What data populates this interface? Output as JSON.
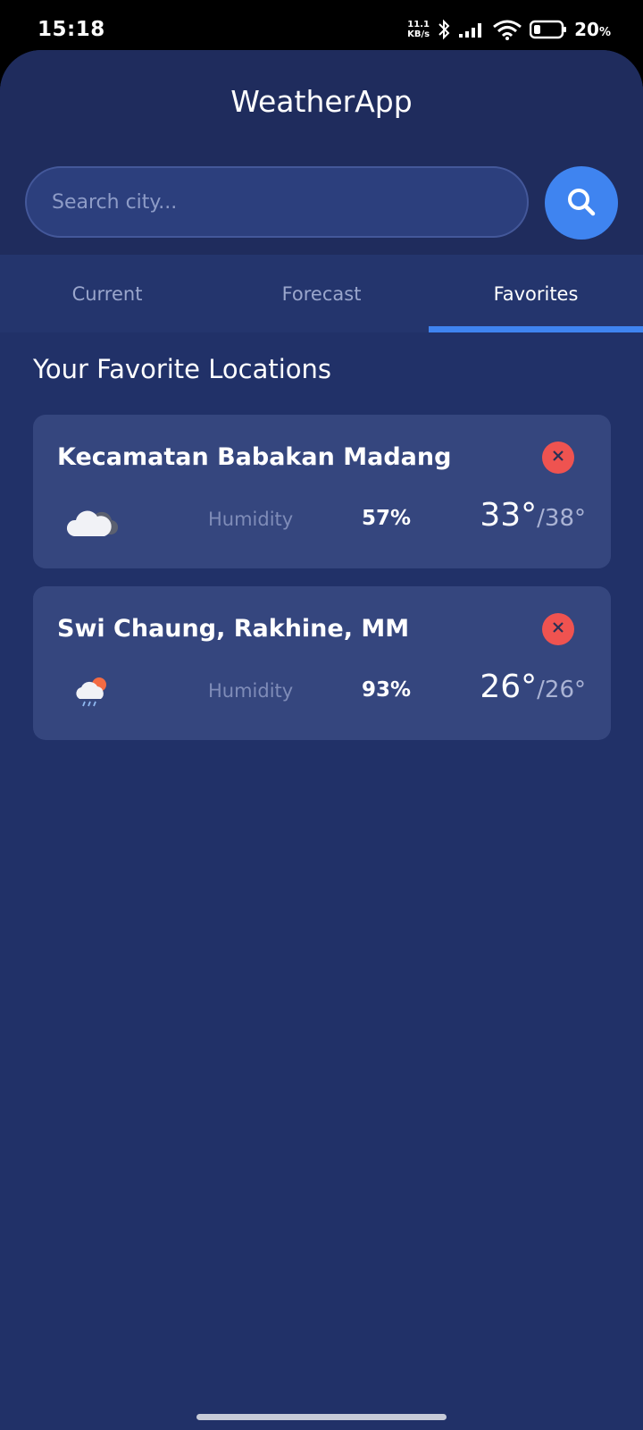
{
  "status_bar": {
    "time": "15:18",
    "net_speed_value": "11.1",
    "net_speed_unit": "KB/s",
    "battery_percent": "20",
    "battery_unit": "%"
  },
  "app": {
    "title": "WeatherApp",
    "search": {
      "placeholder": "Search city..."
    }
  },
  "tabs": [
    {
      "label": "Current",
      "active": false
    },
    {
      "label": "Forecast",
      "active": false
    },
    {
      "label": "Favorites",
      "active": true
    }
  ],
  "favorites": {
    "title": "Your Favorite Locations",
    "items": [
      {
        "name": "Kecamatan Babakan Madang",
        "icon": "cloudy-icon",
        "humidity_label": "Humidity",
        "humidity": "57%",
        "temp_now": "33°",
        "temp_max": "38°"
      },
      {
        "name": "Swi Chaung, Rakhine, MM",
        "icon": "rain-sun-icon",
        "humidity_label": "Humidity",
        "humidity": "93%",
        "temp_now": "26°",
        "temp_max": "26°"
      }
    ]
  },
  "colors": {
    "accent": "#3f84f0",
    "background": "#213168",
    "card": "#35467e",
    "remove": "#ef5350"
  }
}
